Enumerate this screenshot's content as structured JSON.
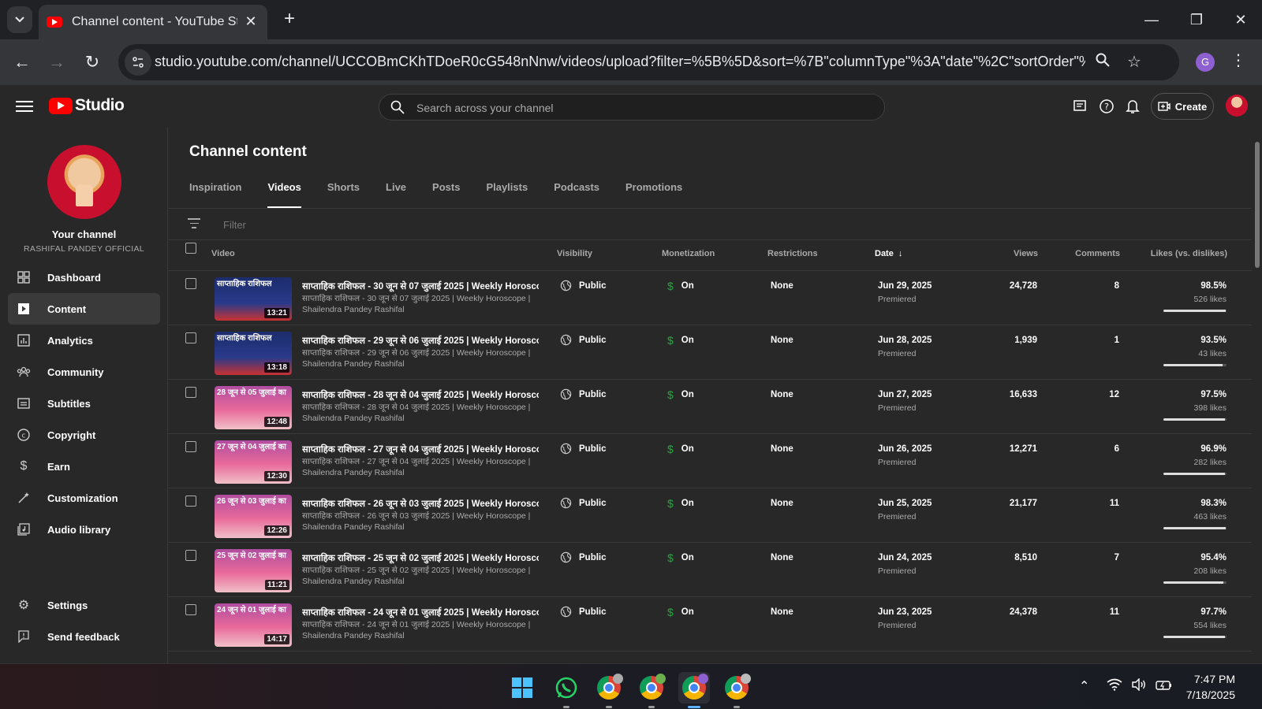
{
  "browser": {
    "tab_title": "Channel content - YouTube Studio",
    "url": "studio.youtube.com/channel/UCCOBmCKhTDoeR0cG548nNnw/videos/upload?filter=%5B%5D&sort=%7B\"columnType\"%3A\"date\"%2C\"sortOrder\"%3A\"D...",
    "profile_initial": "G"
  },
  "header": {
    "logo_text": "Studio",
    "search_placeholder": "Search across your channel",
    "create_label": "Create"
  },
  "sidebar": {
    "channel_title": "Your channel",
    "channel_name": "RASHIFAL PANDEY OFFICIAL",
    "items": [
      {
        "label": "Dashboard",
        "icon": "dashboard-icon"
      },
      {
        "label": "Content",
        "icon": "content-icon"
      },
      {
        "label": "Analytics",
        "icon": "analytics-icon"
      },
      {
        "label": "Community",
        "icon": "community-icon"
      },
      {
        "label": "Subtitles",
        "icon": "subtitles-icon"
      },
      {
        "label": "Copyright",
        "icon": "copyright-icon"
      },
      {
        "label": "Earn",
        "icon": "earn-icon"
      },
      {
        "label": "Customization",
        "icon": "customization-icon"
      },
      {
        "label": "Audio library",
        "icon": "audio-library-icon"
      }
    ],
    "bottom_items": [
      {
        "label": "Settings",
        "icon": "settings-icon"
      },
      {
        "label": "Send feedback",
        "icon": "feedback-icon"
      }
    ]
  },
  "main": {
    "page_title": "Channel content",
    "tabs": [
      "Inspiration",
      "Videos",
      "Shorts",
      "Live",
      "Posts",
      "Playlists",
      "Podcasts",
      "Promotions"
    ],
    "active_tab": "Videos",
    "filter_placeholder": "Filter",
    "columns": {
      "video": "Video",
      "visibility": "Visibility",
      "monetization": "Monetization",
      "restrictions": "Restrictions",
      "date": "Date",
      "views": "Views",
      "comments": "Comments",
      "likes": "Likes (vs. dislikes)"
    },
    "rows": [
      {
        "title": "साप्ताहिक राशिफल - 30 जून से 07 जुलाई 2025 | Weekly Horoscop...",
        "desc1": "साप्ताहिक राशिफल - 30 जून से 07 जुलाई 2025 | Weekly Horoscope |",
        "desc2": "Shailendra Pandey Rashifal",
        "duration": "13:21",
        "thumb_text": "साप्ताहिक राशिफल",
        "thumb_style": "blue",
        "visibility": "Public",
        "monetization": "On",
        "restrictions": "None",
        "date": "Jun 29, 2025",
        "date_sub": "Premiered",
        "views": "24,728",
        "comments": "8",
        "likes_pct": "98.5%",
        "likes_count": "526 likes",
        "likes_ratio": 0.985
      },
      {
        "title": "साप्ताहिक राशिफल - 29 जून से 06 जुलाई 2025 | Weekly Horoscop...",
        "desc1": "साप्ताहिक राशिफल - 29 जून से 06 जुलाई 2025 | Weekly Horoscope |",
        "desc2": "Shailendra Pandey Rashifal",
        "duration": "13:18",
        "thumb_text": "साप्ताहिक राशिफल",
        "thumb_style": "blue",
        "visibility": "Public",
        "monetization": "On",
        "restrictions": "None",
        "date": "Jun 28, 2025",
        "date_sub": "Premiered",
        "views": "1,939",
        "comments": "1",
        "likes_pct": "93.5%",
        "likes_count": "43 likes",
        "likes_ratio": 0.935
      },
      {
        "title": "साप्ताहिक राशिफल - 28 जून से 04 जुलाई 2025 | Weekly Horoscop...",
        "desc1": "साप्ताहिक राशिफल - 28 जून से 04 जुलाई 2025 | Weekly Horoscope |",
        "desc2": "Shailendra Pandey Rashifal",
        "duration": "12:48",
        "thumb_text": "28 जून से 05 जुलाई का",
        "thumb_style": "pink",
        "visibility": "Public",
        "monetization": "On",
        "restrictions": "None",
        "date": "Jun 27, 2025",
        "date_sub": "Premiered",
        "views": "16,633",
        "comments": "12",
        "likes_pct": "97.5%",
        "likes_count": "398 likes",
        "likes_ratio": 0.975
      },
      {
        "title": "साप्ताहिक राशिफल - 27 जून से 04 जुलाई 2025 | Weekly Horoscop...",
        "desc1": "साप्ताहिक राशिफल - 27 जून से 04 जुलाई 2025 | Weekly Horoscope |",
        "desc2": "Shailendra Pandey Rashifal",
        "duration": "12:30",
        "thumb_text": "27 जून से 04 जुलाई का",
        "thumb_style": "pink",
        "visibility": "Public",
        "monetization": "On",
        "restrictions": "None",
        "date": "Jun 26, 2025",
        "date_sub": "Premiered",
        "views": "12,271",
        "comments": "6",
        "likes_pct": "96.9%",
        "likes_count": "282 likes",
        "likes_ratio": 0.969
      },
      {
        "title": "साप्ताहिक राशिफल - 26 जून से 03 जुलाई 2025 | Weekly Horoscop...",
        "desc1": "साप्ताहिक राशिफल - 26 जून से 03 जुलाई 2025 | Weekly Horoscope |",
        "desc2": "Shailendra Pandey Rashifal",
        "duration": "12:26",
        "thumb_text": "26 जून से 03 जुलाई का",
        "thumb_style": "pink",
        "visibility": "Public",
        "monetization": "On",
        "restrictions": "None",
        "date": "Jun 25, 2025",
        "date_sub": "Premiered",
        "views": "21,177",
        "comments": "11",
        "likes_pct": "98.3%",
        "likes_count": "463 likes",
        "likes_ratio": 0.983
      },
      {
        "title": "साप्ताहिक राशिफल - 25 जून से 02 जुलाई 2025 | Weekly Horoscop...",
        "desc1": "साप्ताहिक राशिफल - 25 जून से 02 जुलाई 2025 | Weekly Horoscope |",
        "desc2": "Shailendra Pandey Rashifal",
        "duration": "11:21",
        "thumb_text": "25 जून से 02 जुलाई का",
        "thumb_style": "pink",
        "visibility": "Public",
        "monetization": "On",
        "restrictions": "None",
        "date": "Jun 24, 2025",
        "date_sub": "Premiered",
        "views": "8,510",
        "comments": "7",
        "likes_pct": "95.4%",
        "likes_count": "208 likes",
        "likes_ratio": 0.954
      },
      {
        "title": "साप्ताहिक राशिफल - 24 जून से 01 जुलाई 2025 | Weekly Horoscop...",
        "desc1": "साप्ताहिक राशिफल - 24 जून से 01 जुलाई 2025 | Weekly Horoscope |",
        "desc2": "Shailendra Pandey Rashifal",
        "duration": "14:17",
        "thumb_text": "24 जून से 01 जुलाई का",
        "thumb_style": "pink",
        "visibility": "Public",
        "monetization": "On",
        "restrictions": "None",
        "date": "Jun 23, 2025",
        "date_sub": "Premiered",
        "views": "24,378",
        "comments": "11",
        "likes_pct": "97.7%",
        "likes_count": "554 likes",
        "likes_ratio": 0.977
      }
    ]
  },
  "taskbar": {
    "time": "7:47 PM",
    "date": "7/18/2025"
  },
  "colors": {
    "accent_red": "#ff0000",
    "monetization_green": "#2ba640",
    "background": "#282828"
  }
}
